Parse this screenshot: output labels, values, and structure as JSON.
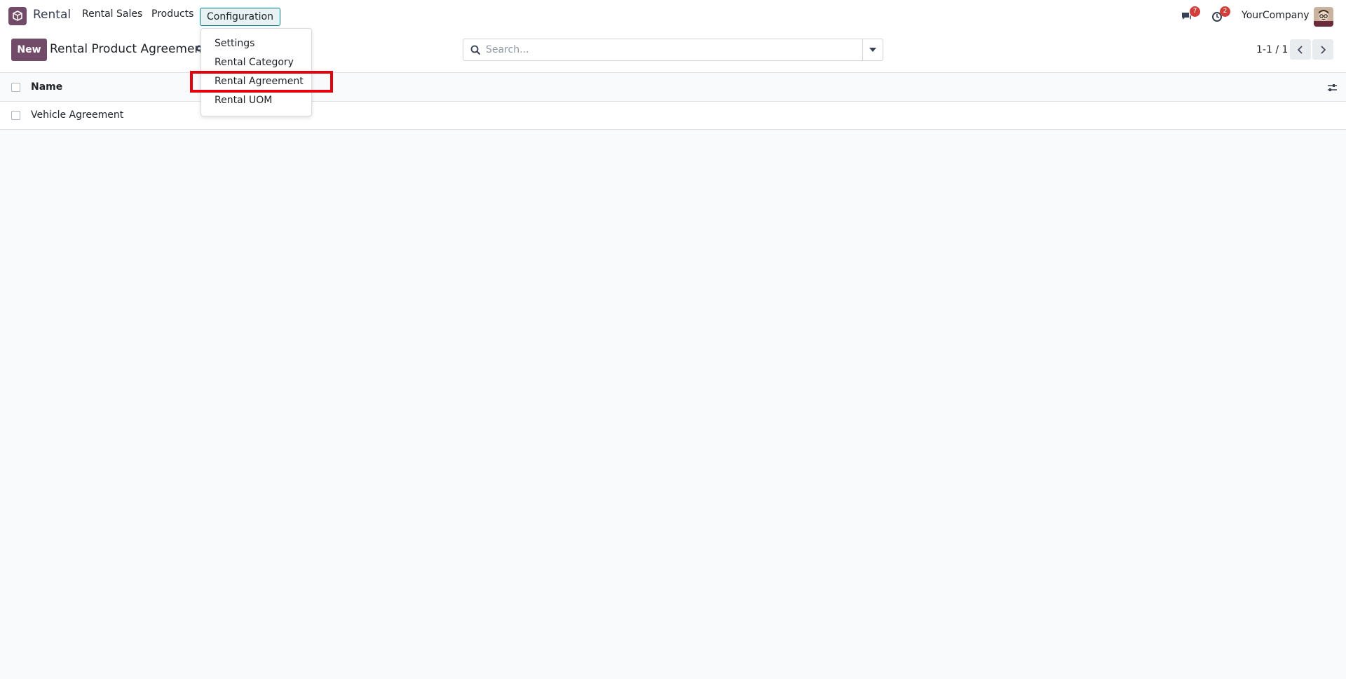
{
  "navbar": {
    "app_name": "Rental",
    "menu": [
      "Rental Sales",
      "Products",
      "Configuration"
    ],
    "messages_count": "7",
    "activities_count": "2",
    "company": "YourCompany"
  },
  "control_panel": {
    "new_label": "New",
    "title": "Rental Product Agreement",
    "search_placeholder": "Search...",
    "pager": "1-1 / 1"
  },
  "configuration_menu": {
    "items": [
      "Settings",
      "Rental Category",
      "Rental Agreement",
      "Rental UOM"
    ],
    "highlighted": "Rental Agreement"
  },
  "list": {
    "columns": [
      "Name"
    ],
    "rows": [
      {
        "name": "Vehicle Agreement"
      }
    ]
  },
  "colors": {
    "brand": "#714b67",
    "accent": "#017e84",
    "badge": "#d23f3a",
    "highlight": "#e3000f"
  }
}
